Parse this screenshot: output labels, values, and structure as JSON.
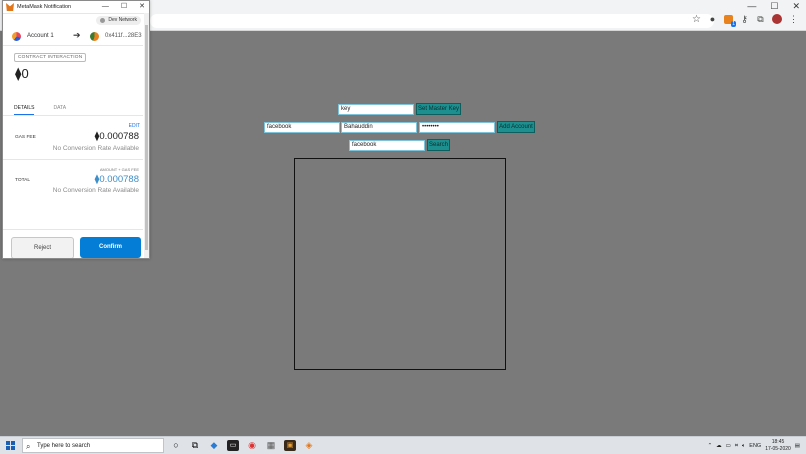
{
  "browser": {
    "win_min": "—",
    "win_max": "☐",
    "win_close": "✕"
  },
  "page": {
    "key_input": "key",
    "set_master_key": "Set Master Key",
    "site_input": "facebook",
    "username_input": "Bahauddin",
    "password_input": "••••••••",
    "add_account": "Add Account",
    "search_input": "facebook",
    "search_button": "Search"
  },
  "metamask": {
    "title": "MetaMask Notification",
    "network": "Dev Network",
    "account_name": "Account 1",
    "to_address": "0x411f...28E3",
    "badge": "CONTRACT INTERACTION",
    "amount": "0",
    "eth_symbol": "⧫",
    "tabs": [
      "DETAILS",
      "DATA"
    ],
    "edit": "EDIT",
    "gas_fee_label": "GAS FEE",
    "gas_fee_value": "0.000788",
    "no_conversion": "No Conversion Rate Available",
    "amount_gas_label": "AMOUNT + GAS FEE",
    "total_label": "TOTAL",
    "total_value": "0.000788",
    "reject": "Reject",
    "confirm": "Confirm"
  },
  "taskbar": {
    "search_placeholder": "Type here to search",
    "language": "ENG",
    "time": "18:45",
    "date": "17-05-2020"
  }
}
